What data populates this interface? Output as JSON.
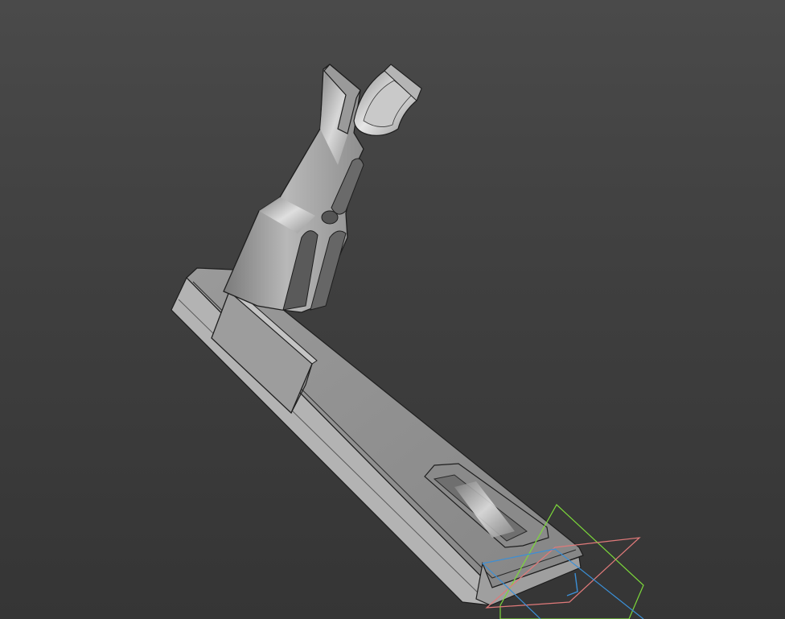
{
  "viewport": {
    "background_top": "#4a4a4a",
    "background_bottom": "#353535",
    "model_face_color": "#8d8d8d",
    "model_edge_color": "#1a1a1a"
  },
  "datum_planes": [
    {
      "name": "green-plane",
      "color": "#7cd83a"
    },
    {
      "name": "red-plane",
      "color": "#e07a7a"
    },
    {
      "name": "blue-plane",
      "color": "#3b8fd6"
    }
  ]
}
